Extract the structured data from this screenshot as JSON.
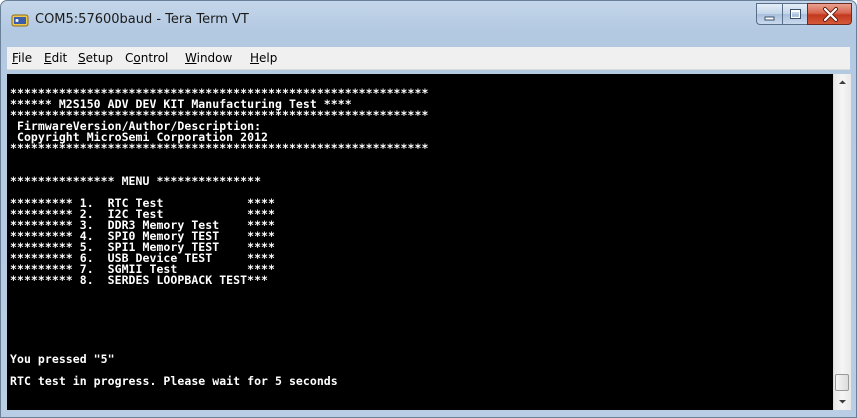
{
  "window": {
    "title": "COM5:57600baud - Tera Term VT"
  },
  "menu": {
    "items": [
      {
        "mnemonic": "F",
        "rest": "ile"
      },
      {
        "mnemonic": "E",
        "rest": "dit"
      },
      {
        "mnemonic": "S",
        "rest": "etup"
      },
      {
        "pre": "C",
        "mnemonic": "o",
        "rest": "ntrol"
      },
      {
        "mnemonic": "W",
        "rest": "indow"
      },
      {
        "mnemonic": "H",
        "rest": "elp"
      }
    ]
  },
  "terminal": {
    "lines": [
      "************************************************************",
      "****** M2S150 ADV DEV KIT Manufacturing Test ****",
      "************************************************************",
      " FirmwareVersion/Author/Description:",
      " Copyright MicroSemi Corporation 2012",
      "************************************************************",
      "",
      "",
      "*************** MENU ***************",
      "",
      "********* 1.  RTC Test            ****",
      "********* 2.  I2C Test            ****",
      "********* 3.  DDR3 Memory Test    ****",
      "********* 4.  SPI0 Memory TEST    ****",
      "********* 5.  SPI1 Memory TEST    ****",
      "********* 6.  USB Device TEST     ****",
      "********* 7.  SGMII Test          ****",
      "********* 8.  SERDES LOOPBACK TEST***",
      "",
      "You pressed \"5\"",
      "",
      "RTC test in progress. Please wait for 5 seconds"
    ]
  },
  "icons": {
    "app": "tera-term-icon",
    "minimize": "minimize-icon",
    "maximize": "maximize-icon",
    "close": "close-icon",
    "scroll_up": "scroll-up-arrow-icon",
    "scroll_down": "scroll-down-arrow-icon"
  },
  "colors": {
    "terminal_bg": "#000000",
    "terminal_fg": "#ffffff",
    "close_button": "#c8452a"
  }
}
